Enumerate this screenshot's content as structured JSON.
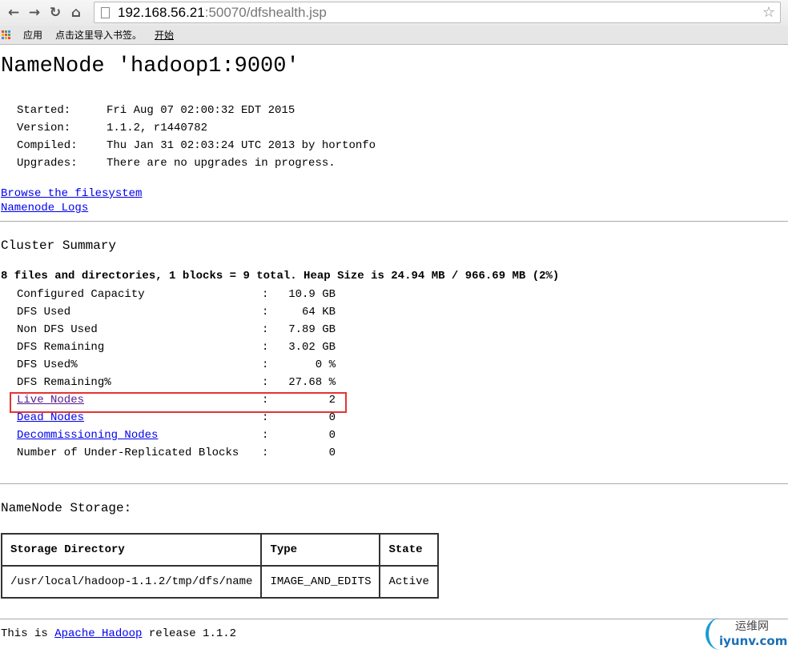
{
  "browser": {
    "url_host": "192.168.56.21",
    "url_path": ":50070/dfshealth.jsp",
    "bookmarks": [
      "应用",
      "点击这里导入书签。",
      "开始"
    ]
  },
  "title": "NameNode 'hadoop1:9000'",
  "info": [
    {
      "k": "Started:",
      "v": "Fri Aug 07 02:00:32 EDT 2015"
    },
    {
      "k": "Version:",
      "v": "1.1.2, r1440782"
    },
    {
      "k": "Compiled:",
      "v": "Thu Jan 31 02:03:24 UTC 2013 by hortonfo"
    },
    {
      "k": "Upgrades:",
      "v": "There are no upgrades in progress."
    }
  ],
  "links": {
    "browse": "Browse the filesystem",
    "logs": "Namenode Logs"
  },
  "cluster": {
    "heading": "Cluster Summary",
    "summary": "8 files and directories, 1 blocks = 9 total. Heap Size is 24.94 MB / 966.69 MB (2%)",
    "stats": [
      {
        "k": "Configured Capacity",
        "v": "10.9 GB"
      },
      {
        "k": "DFS Used",
        "v": "64 KB"
      },
      {
        "k": "Non DFS Used",
        "v": "7.89 GB"
      },
      {
        "k": "DFS Remaining",
        "v": "3.02 GB"
      },
      {
        "k": "DFS Used%",
        "v": "0 %"
      },
      {
        "k": "DFS Remaining%",
        "v": "27.68 %"
      },
      {
        "k": "Live Nodes",
        "v": "2"
      },
      {
        "k": "Dead Nodes",
        "v": "0"
      },
      {
        "k": "Decommissioning Nodes",
        "v": "0"
      },
      {
        "k": "Number of Under-Replicated Blocks",
        "v": "0"
      }
    ],
    "sep": ":"
  },
  "storage": {
    "heading": "NameNode Storage:",
    "headers": [
      "Storage Directory",
      "Type",
      "State"
    ],
    "row": [
      "/usr/local/hadoop-1.1.2/tmp/dfs/name",
      "IMAGE_AND_EDITS",
      "Active"
    ]
  },
  "footer": {
    "pre": "This is ",
    "link": "Apache Hadoop",
    "post": " release 1.1.2"
  },
  "watermark": {
    "cn": "运维网",
    "en": "iyunv.com"
  }
}
